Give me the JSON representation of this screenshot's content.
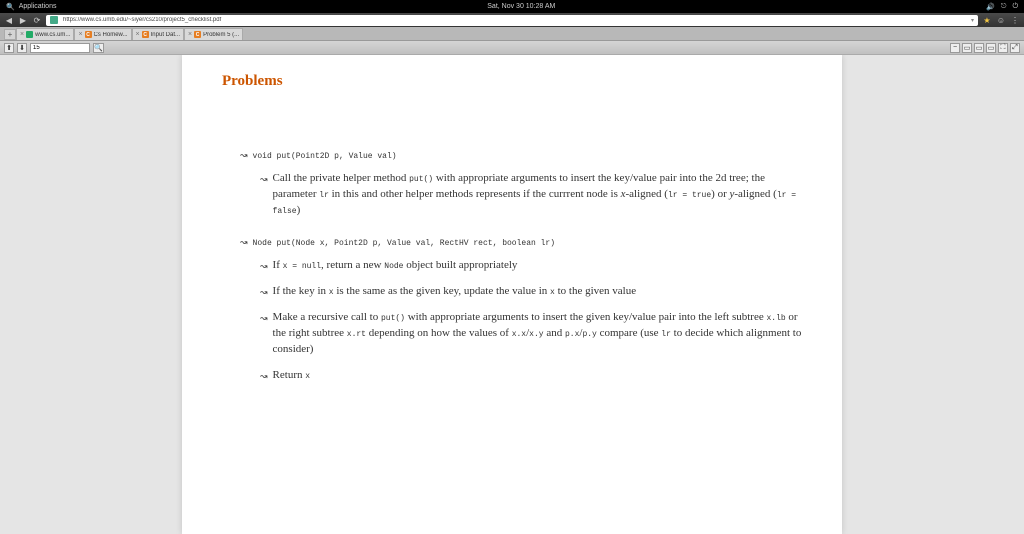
{
  "osbar": {
    "applications": "Applications",
    "datetime": "Sat, Nov 30   10:28 AM",
    "icons": [
      "vol-icon",
      "bt-icon",
      "power-icon"
    ]
  },
  "nav": {
    "url": "https://www.cs.umb.edu/~siyer/cs210/project5_checklist.pdf"
  },
  "tabs": [
    {
      "label": "www.cs.um...",
      "fav": "fav-e"
    },
    {
      "label": "Cs Homew...",
      "fav": "fav-c",
      "letter": "C"
    },
    {
      "label": "Input Dat...",
      "fav": "fav-c",
      "letter": "C"
    },
    {
      "label": "Problem 5 (...",
      "fav": "fav-c",
      "letter": "C"
    }
  ],
  "findbar": {
    "page": "15"
  },
  "doc": {
    "heading": "Problems",
    "sig1": "void put(Point2D p, Value val)",
    "b1": "Call the private helper method put() with appropriate arguments to insert the key/value pair into the 2d tree; the parameter lr in this and other helper methods represents if the currrent node is x-aligned (lr = true) or y-aligned (lr = false)",
    "sig2": "Node put(Node x, Point2D p, Value val, RectHV rect, boolean lr)",
    "b2": "If x = null, return a new Node object built appropriately",
    "b3": "If the key in x is the same as the given key, update the value in x to the given value",
    "b4": "Make a recursive call to put() with appropriate arguments to insert the given key/value pair into the left subtree x.lb or the right subtree x.rt depending on how the values of x.x/x.y and p.x/p.y compare (use lr to decide which alignment to consider)",
    "b5": "Return x"
  }
}
